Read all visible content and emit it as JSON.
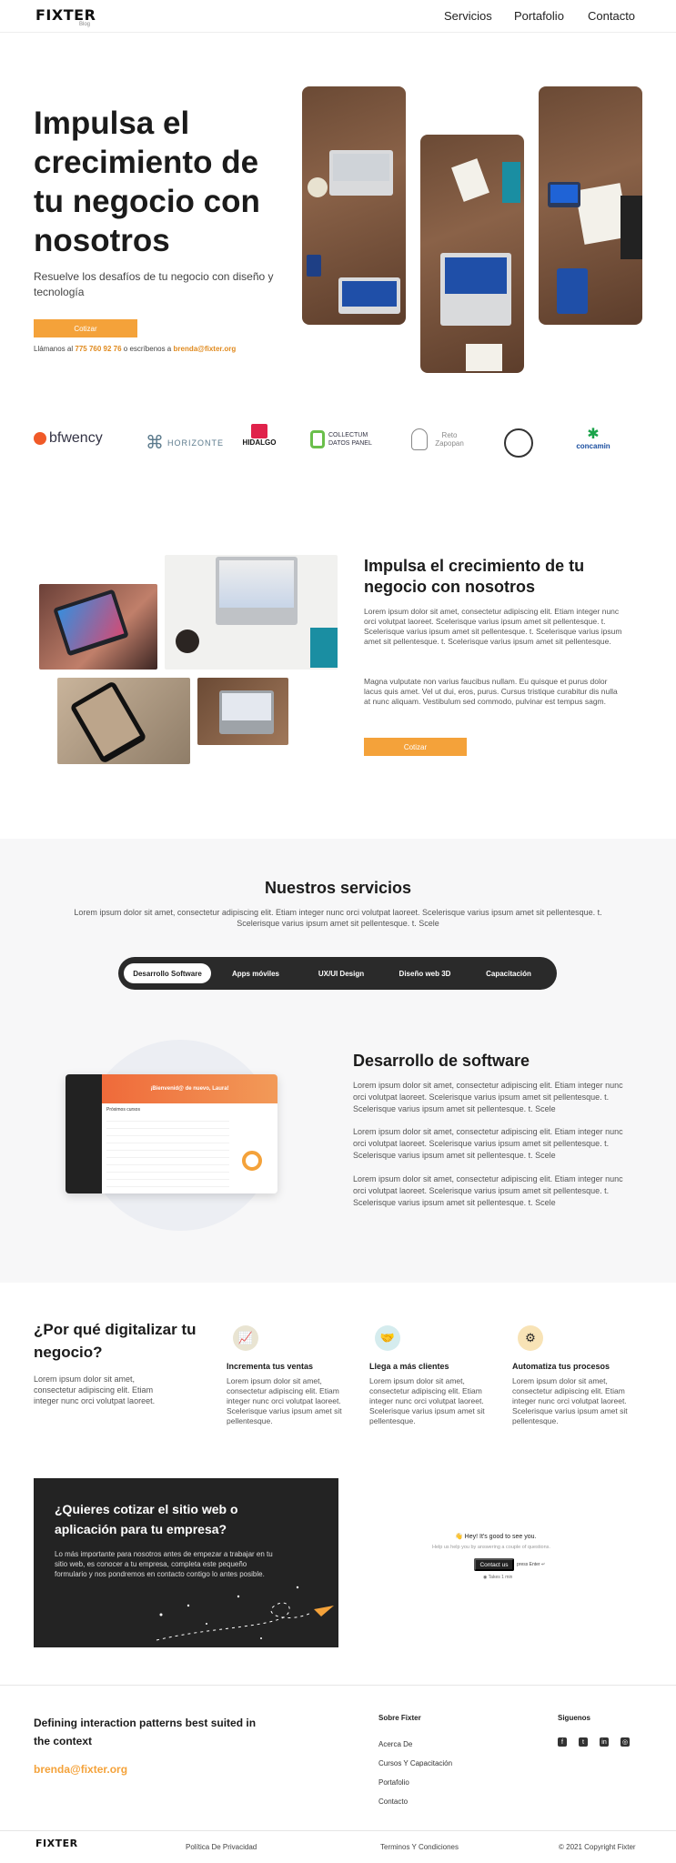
{
  "header": {
    "logo_text": "FIXTER",
    "logo_sub": "Blog",
    "nav": [
      "Servicios",
      "Portafolio",
      "Contacto"
    ]
  },
  "hero": {
    "title": "Impulsa el crecimiento de tu negocio con nosotros",
    "subtitle": "Resuelve los desafíos de tu negocio con diseño y tecnología",
    "cta_label": "Cotizar",
    "contact_prefix": "Llámanos al",
    "phone": "775 760 92 76",
    "contact_middle": "o escríbenos a",
    "email": "brenda@fixter.org"
  },
  "brands": [
    "bfwency",
    "HORIZONTE",
    "HIDALGO",
    "COLLECTUM DATOS PANEL",
    "Reto Zapopan",
    "",
    "concamin"
  ],
  "feature": {
    "title": "Impulsa el crecimiento de tu negocio con nosotros",
    "p1": "Lorem ipsum dolor sit amet, consectetur adipiscing elit. Etiam integer nunc orci volutpat laoreet. Scelerisque varius ipsum amet sit pellentesque. t. Scelerisque varius ipsum amet sit pellentesque. t. Scelerisque varius ipsum amet sit pellentesque. t. Scelerisque varius ipsum amet sit pellentesque.",
    "p2": "Magna vulputate non varius faucibus nullam. Eu quisque et purus dolor lacus quis amet. Vel ut dui, eros, purus. Cursus tristique curabitur dis nulla at nunc aliquam. Vestibulum sed commodo, pulvinar est tempus sagm.",
    "cta_label": "Cotizar"
  },
  "services": {
    "title": "Nuestros servicios",
    "subtitle": "Lorem ipsum dolor sit amet, consectetur adipiscing elit. Etiam integer nunc orci volutpat laoreet. Scelerisque varius ipsum amet sit pellentesque. t. Scelerisque varius ipsum amet sit pellentesque. t. Scele",
    "tabs": [
      "Desarrollo Software",
      "Apps móviles",
      "UX/UI Design",
      "Diseño web 3D",
      "Capacitación"
    ],
    "active_tab": 0,
    "panel": {
      "title": "Desarrollo de software",
      "p1": "Lorem ipsum dolor sit amet, consectetur adipiscing elit. Etiam integer nunc orci volutpat laoreet. Scelerisque varius ipsum amet sit pellentesque. t. Scelerisque varius ipsum amet sit pellentesque. t. Scele",
      "p2": "Lorem ipsum dolor sit amet, consectetur adipiscing elit. Etiam integer nunc orci volutpat laoreet. Scelerisque varius ipsum amet sit pellentesque. t. Scelerisque varius ipsum amet sit pellentesque. t. Scele",
      "p3": "Lorem ipsum dolor sit amet, consectetur adipiscing elit. Etiam integer nunc orci volutpat laoreet. Scelerisque varius ipsum amet sit pellentesque. t. Scelerisque varius ipsum amet sit pellentesque. t. Scele",
      "mock_banner": "¡Bienvenid@ de nuevo, Laura!",
      "mock_list_title": "Próximos cursos"
    }
  },
  "why": {
    "title": "¿Por qué digitalizar tu negocio?",
    "text": "Lorem ipsum dolor sit amet, consectetur adipiscing elit. Etiam integer nunc orci volutpat laoreet.",
    "items": [
      {
        "title": "Incrementa tus ventas",
        "text": "Lorem ipsum dolor sit amet, consectetur adipiscing elit. Etiam integer nunc orci volutpat laoreet. Scelerisque varius ipsum amet sit pellentesque.",
        "icon": "chart-icon"
      },
      {
        "title": "Llega a más clientes",
        "text": "Lorem ipsum dolor sit amet, consectetur adipiscing elit. Etiam integer nunc orci volutpat laoreet. Scelerisque varius ipsum amet sit pellentesque.",
        "icon": "handshake-icon"
      },
      {
        "title": "Automatiza tus procesos",
        "text": "Lorem ipsum dolor sit amet, consectetur adipiscing elit. Etiam integer nunc orci volutpat laoreet. Scelerisque varius ipsum amet sit pellentesque.",
        "icon": "gear-icon"
      }
    ]
  },
  "cta": {
    "title": "¿Quieres cotizar el sitio web o aplicación para tu empresa?",
    "text": "Lo más importante para nosotros antes de empezar a trabajar en tu sitio web, es conocer a tu empresa, completa este pequeño formulario y nos pondremos en contacto contigo lo antes posible.",
    "chat_hello": "👋 Hey! It's good to see you.",
    "chat_sub": "Help us help you by answering a couple of questions.",
    "chat_button": "Contact us",
    "chat_side": "press Enter ↵",
    "chat_footer": "◉ Takes 1 min"
  },
  "footer": {
    "tagline": "Defining interaction patterns best suited in the context",
    "email": "brenda@fixter.org",
    "about_heading": "Sobre Fixter",
    "about_links": [
      "Acerca De",
      "Cursos Y Capacitación",
      "Portafolio",
      "Contacto"
    ],
    "social_heading": "Siguenos",
    "social": [
      "facebook-icon",
      "twitter-icon",
      "linkedin-icon",
      "instagram-icon"
    ],
    "privacy": "Política De Privacidad",
    "terms": "Terminos Y Condiciones",
    "copyright": "© 2021 Copyright Fixter"
  },
  "colors": {
    "accent": "#f4a23a",
    "dark": "#232323",
    "light_bg": "#f7f7f8"
  }
}
